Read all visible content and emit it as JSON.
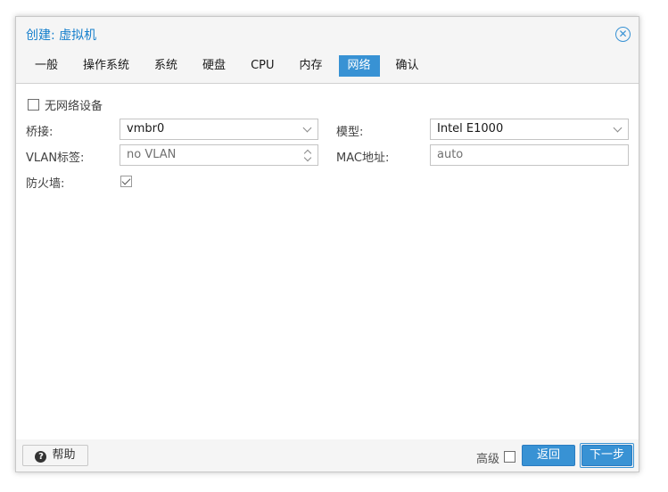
{
  "dialog": {
    "title": "创建: 虚拟机"
  },
  "tabs": [
    {
      "label": "一般",
      "active": false
    },
    {
      "label": "操作系统",
      "active": false
    },
    {
      "label": "系统",
      "active": false
    },
    {
      "label": "硬盘",
      "active": false
    },
    {
      "label": "CPU",
      "active": false
    },
    {
      "label": "内存",
      "active": false
    },
    {
      "label": "网络",
      "active": true
    },
    {
      "label": "确认",
      "active": false
    }
  ],
  "form": {
    "no_network_label": "无网络设备",
    "no_network_checked": false,
    "bridge_label": "桥接:",
    "bridge_value": "vmbr0",
    "model_label": "模型:",
    "model_value": "Intel E1000",
    "vlan_label": "VLAN标签:",
    "vlan_placeholder": "no VLAN",
    "mac_label": "MAC地址:",
    "mac_value": "auto",
    "firewall_label": "防火墙:",
    "firewall_checked": true
  },
  "footer": {
    "help_label": "帮助",
    "advanced_label": "高级",
    "advanced_checked": false,
    "back_label": "返回",
    "next_label": "下一步"
  },
  "colors": {
    "accent": "#3892d4",
    "title": "#157fcc"
  }
}
